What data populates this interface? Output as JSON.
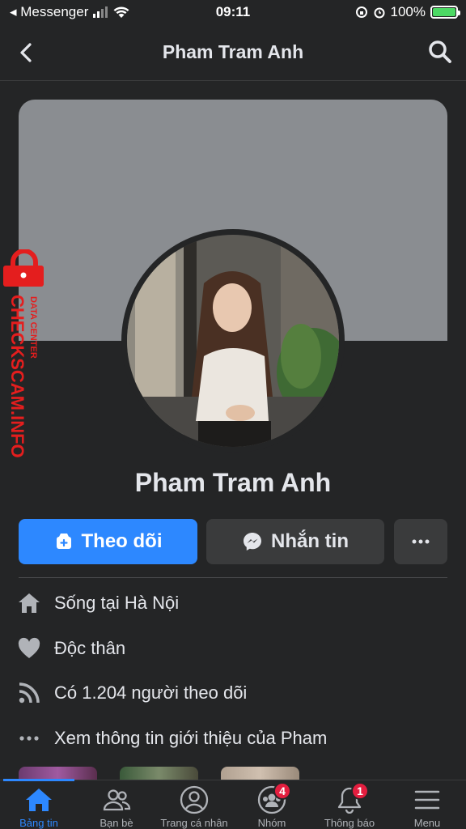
{
  "status_bar": {
    "app": "◂ Messenger",
    "time": "09:11",
    "battery": "100%"
  },
  "header": {
    "title": "Pham Tram Anh"
  },
  "watermark": {
    "main": "CHECKSCAM.INFO",
    "sub": "DATA CENTER"
  },
  "profile": {
    "name": "Pham Tram Anh"
  },
  "actions": {
    "follow": "Theo dõi",
    "message": "Nhắn tin"
  },
  "info": [
    {
      "icon": "home-icon",
      "text": "Sống tại Hà Nội"
    },
    {
      "icon": "heart-icon",
      "text": "Độc thân"
    },
    {
      "icon": "rss-icon",
      "text": "Có 1.204 người theo dõi"
    },
    {
      "icon": "more-dots-icon",
      "text": "Xem thông tin giới thiệu của Pham"
    }
  ],
  "tabs": [
    {
      "label": "Bảng tin",
      "icon": "home-icon",
      "active": true
    },
    {
      "label": "Bạn bè",
      "icon": "friends-icon"
    },
    {
      "label": "Trang cá nhân",
      "icon": "profile-icon"
    },
    {
      "label": "Nhóm",
      "icon": "groups-icon",
      "badge": "4"
    },
    {
      "label": "Thông báo",
      "icon": "bell-icon",
      "badge": "1"
    },
    {
      "label": "Menu",
      "icon": "menu-icon"
    }
  ],
  "colors": {
    "background": "#242526",
    "accent": "#2d88ff",
    "badge": "#e41e3f",
    "cover": "#8a8d91"
  }
}
